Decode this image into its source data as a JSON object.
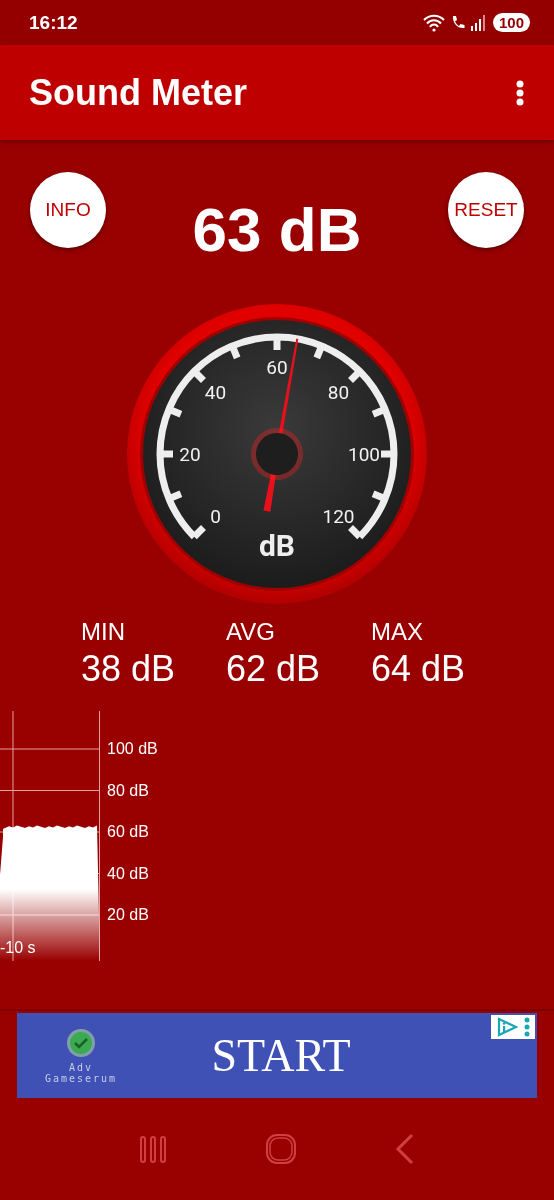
{
  "status_bar": {
    "time": "16:12",
    "battery": "100"
  },
  "app_bar": {
    "title": "Sound Meter"
  },
  "buttons": [
    {
      "label": "INFO"
    },
    {
      "label": "RESET"
    }
  ],
  "reading": "63 dB",
  "gauge": {
    "ticks": [
      "0",
      "20",
      "40",
      "60",
      "80",
      "100",
      "120"
    ],
    "unit": "dB"
  },
  "stats": [
    {
      "label": "MIN",
      "value": "38 dB"
    },
    {
      "label": "AVG",
      "value": "62 dB"
    },
    {
      "label": "MAX",
      "value": "64 dB"
    }
  ],
  "history": {
    "y_labels": [
      "100 dB",
      "80 dB",
      "60 dB",
      "40 dB",
      "20 dB"
    ],
    "x_label": "-10 s"
  },
  "ad": {
    "brand_line_1": "Adv",
    "brand_line_2": "Gameserum",
    "headline": "START"
  }
}
